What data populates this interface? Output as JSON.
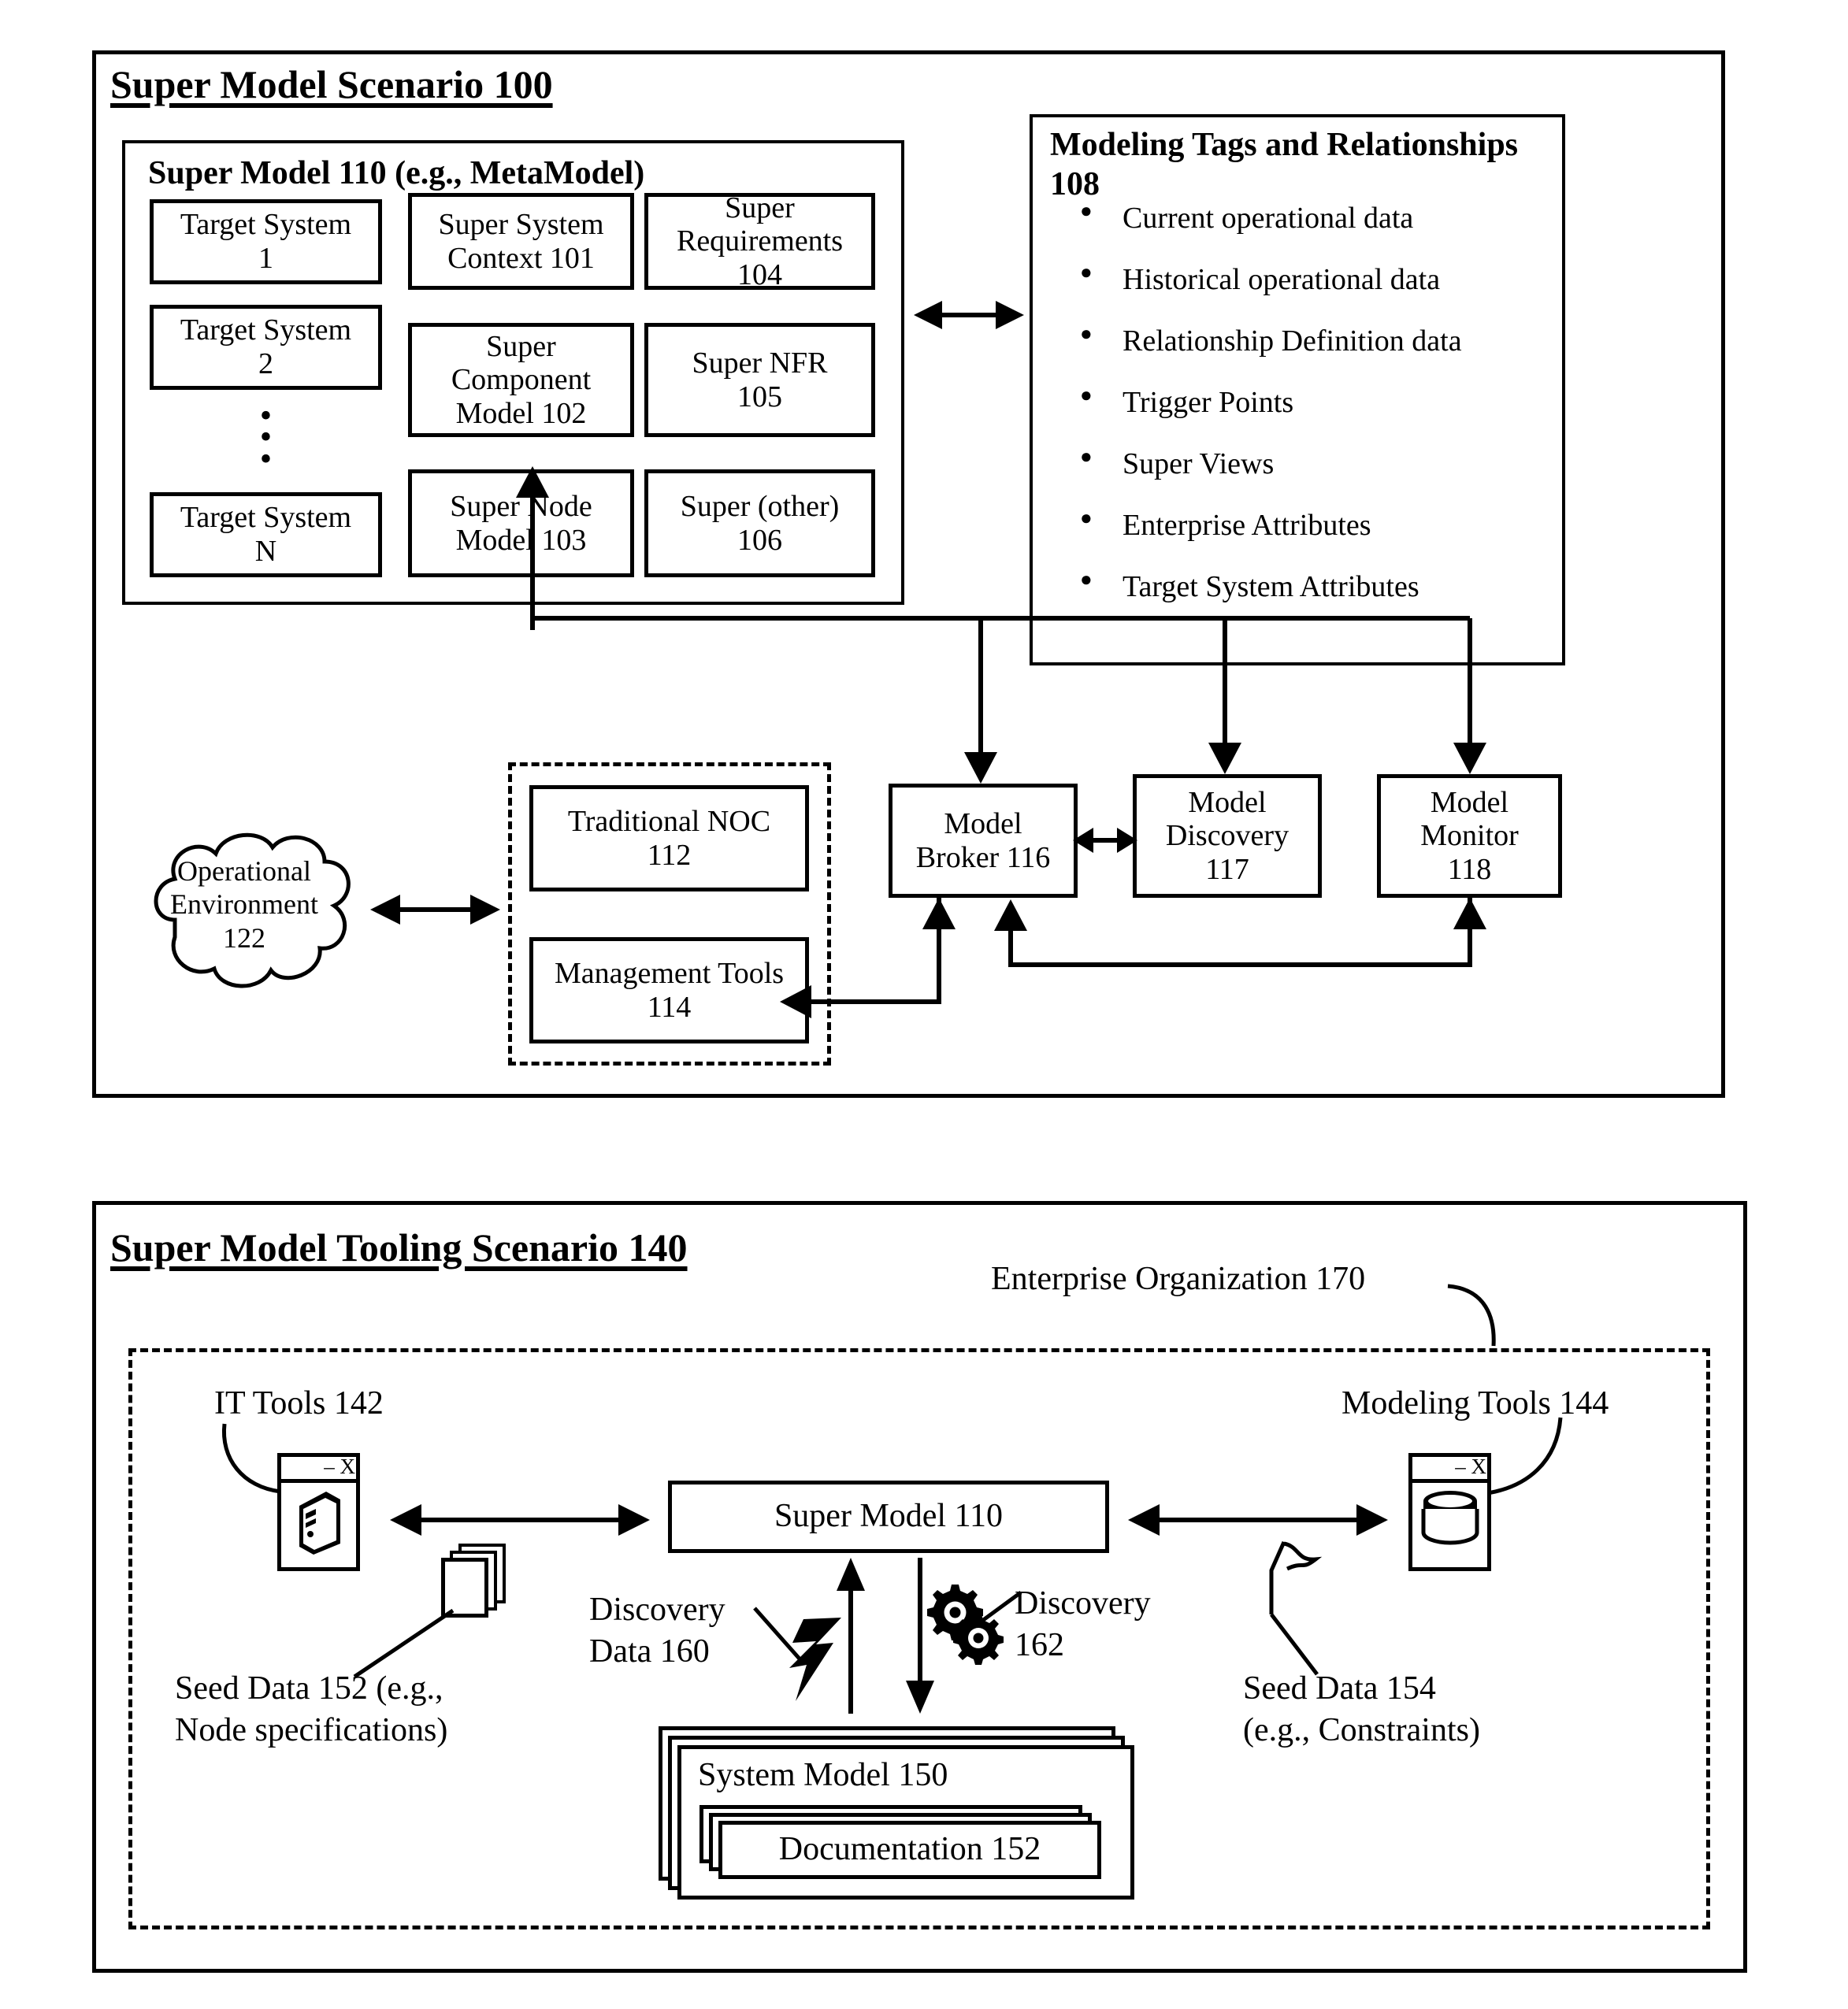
{
  "figure1": {
    "title": "Super Model Scenario 100",
    "super_model": {
      "header": "Super Model 110 (e.g., MetaModel)",
      "target_systems": [
        "Target System\n1",
        "Target System\n2",
        "Target System\nN"
      ],
      "ellipsis": "•\n•\n•",
      "middle_column": [
        "Super System\nContext 101",
        "Super\nComponent\nModel 102",
        "Super Node\nModel 103"
      ],
      "right_column": [
        "Super\nRequirements\n104",
        "Super NFR\n105",
        "Super (other)\n106"
      ]
    },
    "modeling_tags": {
      "header": "Modeling Tags and Relationships 108",
      "items": [
        "Current operational data",
        "Historical operational data",
        "Relationship Definition data",
        "Trigger Points",
        "Super Views",
        "Enterprise Attributes",
        "Target System Attributes"
      ]
    },
    "cloud": "Operational\nEnvironment\n122",
    "noc_group": [
      "Traditional NOC\n112",
      "Management Tools\n114"
    ],
    "services": [
      "Model\nBroker 116",
      "Model\nDiscovery\n117",
      "Model\nMonitor\n118"
    ]
  },
  "figure2": {
    "title": "Super Model Tooling Scenario 140",
    "enterprise_label": "Enterprise Organization 170",
    "it_tools_label": "IT Tools 142",
    "modeling_tools_label": "Modeling Tools 144",
    "it_tools_window": {
      "title_bar": "–  X",
      "icon": "computer-tower-icon"
    },
    "modeling_tools_window": {
      "title_bar": "–  X",
      "icon": "database-cylinder-icon"
    },
    "seed_data_152": "Seed Data 152 (e.g.,\nNode specifications)",
    "seed_data_154": "Seed Data 154\n(e.g., Constraints)",
    "super_model": "Super Model 110",
    "discovery_data_160": "Discovery\nData 160",
    "discovery_162": "Discovery\n162",
    "system_model": "System Model 150",
    "documentation": "Documentation 152"
  }
}
